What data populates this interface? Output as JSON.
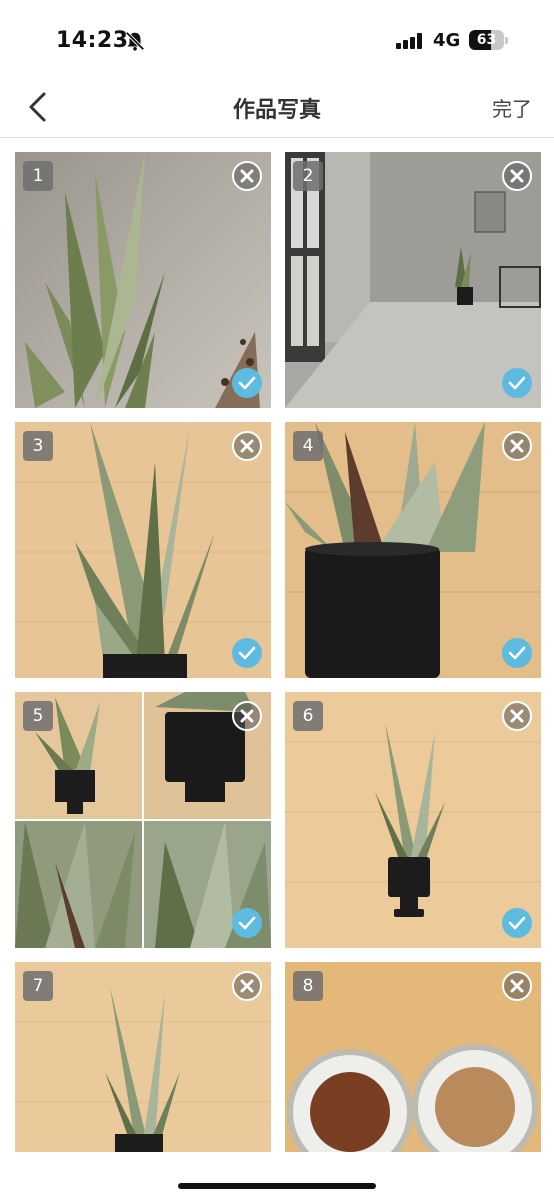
{
  "status_bar": {
    "time": "14:23",
    "network": "4G",
    "battery": "63",
    "battery_level": 0.63
  },
  "nav": {
    "title": "作品写真",
    "done_label": "完了"
  },
  "photos": [
    {
      "number": "1",
      "selected": true
    },
    {
      "number": "2",
      "selected": true
    },
    {
      "number": "3",
      "selected": true
    },
    {
      "number": "4",
      "selected": true
    },
    {
      "number": "5",
      "selected": true
    },
    {
      "number": "6",
      "selected": true
    },
    {
      "number": "7",
      "selected": false
    },
    {
      "number": "8",
      "selected": false
    }
  ],
  "colors": {
    "check": "#5dbbe0",
    "wood": "#e9c796",
    "concrete": "#b7b4ae",
    "plant": "#6f7d52",
    "pot": "#1c1c1c"
  }
}
